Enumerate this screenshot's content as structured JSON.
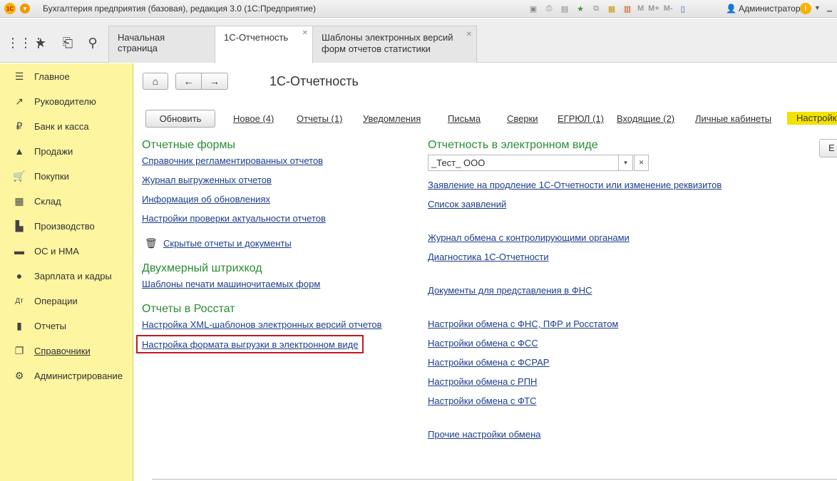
{
  "window": {
    "title": "Бухгалтерия предприятия (базовая), редакция 3.0  (1С:Предприятие)",
    "logo_text": "1С",
    "user": "Администратор",
    "memory_labels": [
      "M",
      "M+",
      "M-"
    ]
  },
  "tabs": [
    {
      "label": "Начальная страница"
    },
    {
      "label": "1С-Отчетность"
    },
    {
      "label": "Шаблоны электронных версий",
      "label2": "форм отчетов статистики"
    }
  ],
  "sidebar": {
    "items": [
      {
        "label": "Главное",
        "icon": "menu-lines-icon"
      },
      {
        "label": "Руководителю",
        "icon": "trend-icon"
      },
      {
        "label": "Банк и касса",
        "icon": "ruble-icon"
      },
      {
        "label": "Продажи",
        "icon": "bag-icon"
      },
      {
        "label": "Покупки",
        "icon": "cart-icon"
      },
      {
        "label": "Склад",
        "icon": "warehouse-icon"
      },
      {
        "label": "Производство",
        "icon": "factory-icon"
      },
      {
        "label": "ОС и НМА",
        "icon": "truck-icon"
      },
      {
        "label": "Зарплата и кадры",
        "icon": "person-icon"
      },
      {
        "label": "Операции",
        "icon": "dt-kt-icon"
      },
      {
        "label": "Отчеты",
        "icon": "bar-chart-icon"
      },
      {
        "label": "Справочники",
        "icon": "books-icon"
      },
      {
        "label": "Администрирование",
        "icon": "gear-icon"
      }
    ]
  },
  "page": {
    "title": "1С-Отчетность",
    "refresh_label": "Обновить",
    "toolbar_links": [
      "Новое (4)",
      "Отчеты (1)",
      "Уведомления",
      "Письма",
      "Сверки",
      "ЕГРЮЛ (1)",
      "Входящие (2)",
      "Личные кабинеты"
    ],
    "settings_label": "Настройки",
    "right_button_label": "Е"
  },
  "left": {
    "section1_title": "Отчетные формы",
    "section1_links": [
      "Справочник регламентированных отчетов",
      "Журнал выгруженных отчетов",
      "Информация об обновлениях",
      "Настройки проверки актуальности отчетов"
    ],
    "hidden_link": "Скрытые отчеты и документы",
    "section2_title": "Двухмерный штрихкод",
    "section2_links": [
      "Шаблоны печати машиночитаемых форм"
    ],
    "section3_title": "Отчеты в Росстат",
    "section3_links": [
      "Настройка XML-шаблонов электронных версий отчетов",
      "Настройка формата выгрузки в электронном виде"
    ]
  },
  "right": {
    "section_title": "Отчетность в электронном виде",
    "org_value": "_Тест_ ООО",
    "links": [
      "Заявление на продление 1С-Отчетности или изменение реквизитов",
      "Список заявлений",
      "Журнал обмена с контролирующими органами",
      "Диагностика 1С-Отчетности",
      "Документы для представления в ФНС",
      "Настройки обмена с ФНС, ПФР и Росстатом",
      "Настройки обмена с ФСС",
      "Настройки обмена с ФСРАР",
      "Настройки обмена с РПН",
      "Настройки обмена с ФТС",
      "Прочие настройки обмена"
    ]
  }
}
